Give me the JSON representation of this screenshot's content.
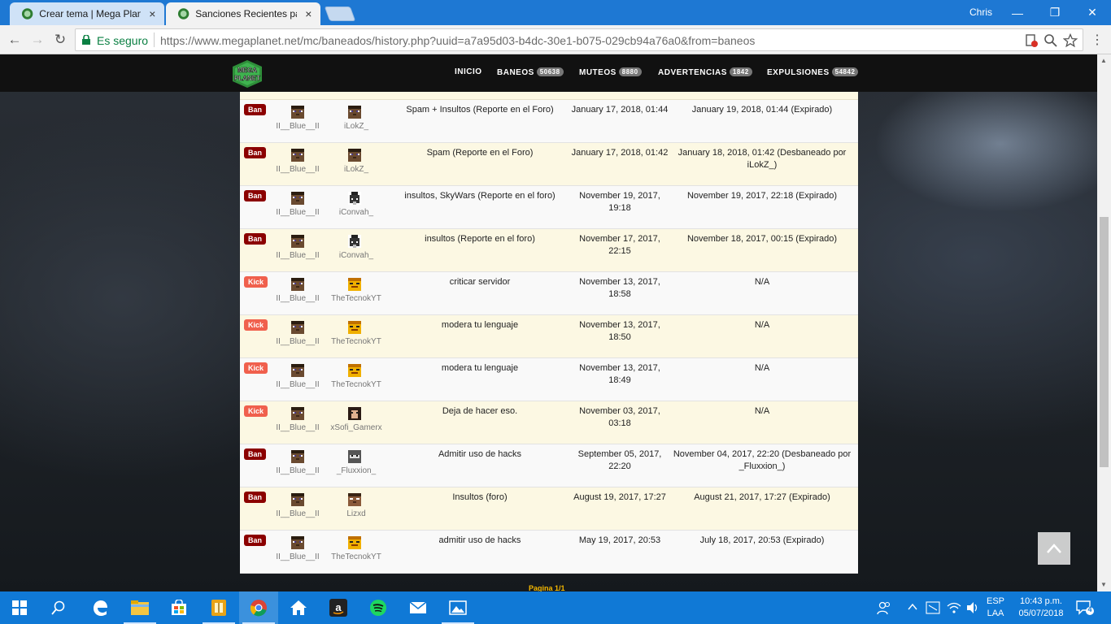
{
  "browser": {
    "tabs": [
      {
        "title": "Crear tema | Mega Planet",
        "close": "×"
      },
      {
        "title": "Sanciones Recientes para",
        "close": "×"
      }
    ],
    "user": "Chris",
    "window_controls": {
      "minimize": "—",
      "maximize": "❐",
      "close": "✕"
    },
    "nav": {
      "back": "←",
      "forward": "→",
      "reload": "↻"
    },
    "secure_label": "Es seguro",
    "url": "https://www.megaplanet.net/mc/baneados/history.php?uuid=a7a95d03-b4dc-30e1-b075-029cb94a76a0&from=baneos",
    "menu": "⋮"
  },
  "site": {
    "logo_text_top": "MEGA",
    "logo_text_bottom": "PLANET",
    "nav": [
      {
        "label": "INICIO",
        "badge": ""
      },
      {
        "label": "BANEOS",
        "badge": "50638"
      },
      {
        "label": "MUTEOS",
        "badge": "8880"
      },
      {
        "label": "ADVERTENCIAS",
        "badge": "1842"
      },
      {
        "label": "EXPULSIONES",
        "badge": "54842"
      }
    ]
  },
  "records": [
    {
      "type": "Ban",
      "staff": "II__Blue__II",
      "player": "iLokZ_",
      "reason": "Spam + Insultos (Reporte en el Foro)",
      "date": "January 17, 2018, 01:44",
      "expires": "January 19, 2018, 01:44 (Expirado)"
    },
    {
      "type": "Ban",
      "staff": "II__Blue__II",
      "player": "iLokZ_",
      "reason": "Spam (Reporte en el Foro)",
      "date": "January 17, 2018, 01:42",
      "expires": "January 18, 2018, 01:42 (Desbaneado por iLokZ_)"
    },
    {
      "type": "Ban",
      "staff": "II__Blue__II",
      "player": "iConvah_",
      "reason": "insultos, SkyWars (Reporte en el foro)",
      "date": "November 19, 2017, 19:18",
      "expires": "November 19, 2017, 22:18 (Expirado)"
    },
    {
      "type": "Ban",
      "staff": "II__Blue__II",
      "player": "iConvah_",
      "reason": "insultos (Reporte en el foro)",
      "date": "November 17, 2017, 22:15",
      "expires": "November 18, 2017, 00:15 (Expirado)"
    },
    {
      "type": "Kick",
      "staff": "II__Blue__II",
      "player": "TheTecnokYT",
      "reason": "criticar servidor",
      "date": "November 13, 2017, 18:58",
      "expires": "N/A"
    },
    {
      "type": "Kick",
      "staff": "II__Blue__II",
      "player": "TheTecnokYT",
      "reason": "modera tu lenguaje",
      "date": "November 13, 2017, 18:50",
      "expires": "N/A"
    },
    {
      "type": "Kick",
      "staff": "II__Blue__II",
      "player": "TheTecnokYT",
      "reason": "modera tu lenguaje",
      "date": "November 13, 2017, 18:49",
      "expires": "N/A"
    },
    {
      "type": "Kick",
      "staff": "II__Blue__II",
      "player": "xSofi_Gamerx",
      "reason": "Deja de hacer eso.",
      "date": "November 03, 2017, 03:18",
      "expires": "N/A"
    },
    {
      "type": "Ban",
      "staff": "II__Blue__II",
      "player": "_Fluxxion_",
      "reason": "Admitir uso de hacks",
      "date": "September 05, 2017, 22:20",
      "expires": "November 04, 2017, 22:20 (Desbaneado por _Fluxxion_)"
    },
    {
      "type": "Ban",
      "staff": "II__Blue__II",
      "player": "Lizxd",
      "reason": "Insultos (foro)",
      "date": "August 19, 2017, 17:27",
      "expires": "August 21, 2017, 17:27 (Expirado)"
    },
    {
      "type": "Ban",
      "staff": "II__Blue__II",
      "player": "TheTecnokYT",
      "reason": "admitir uso de hacks",
      "date": "May 19, 2017, 20:53",
      "expires": "July 18, 2017, 20:53 (Expirado)"
    }
  ],
  "pagination": "Pagina 1/1",
  "taskbar": {
    "lang_top": "ESP",
    "lang_bottom": "LAA",
    "time": "10:43 p.m.",
    "date": "05/07/2018",
    "notifications": "4"
  },
  "colors": {
    "ban_badge": "#8b0000",
    "kick_badge": "#f0604d",
    "row_alt": "#fcf8e3",
    "taskbar": "#1079d6",
    "pagination": "#f5b800"
  }
}
